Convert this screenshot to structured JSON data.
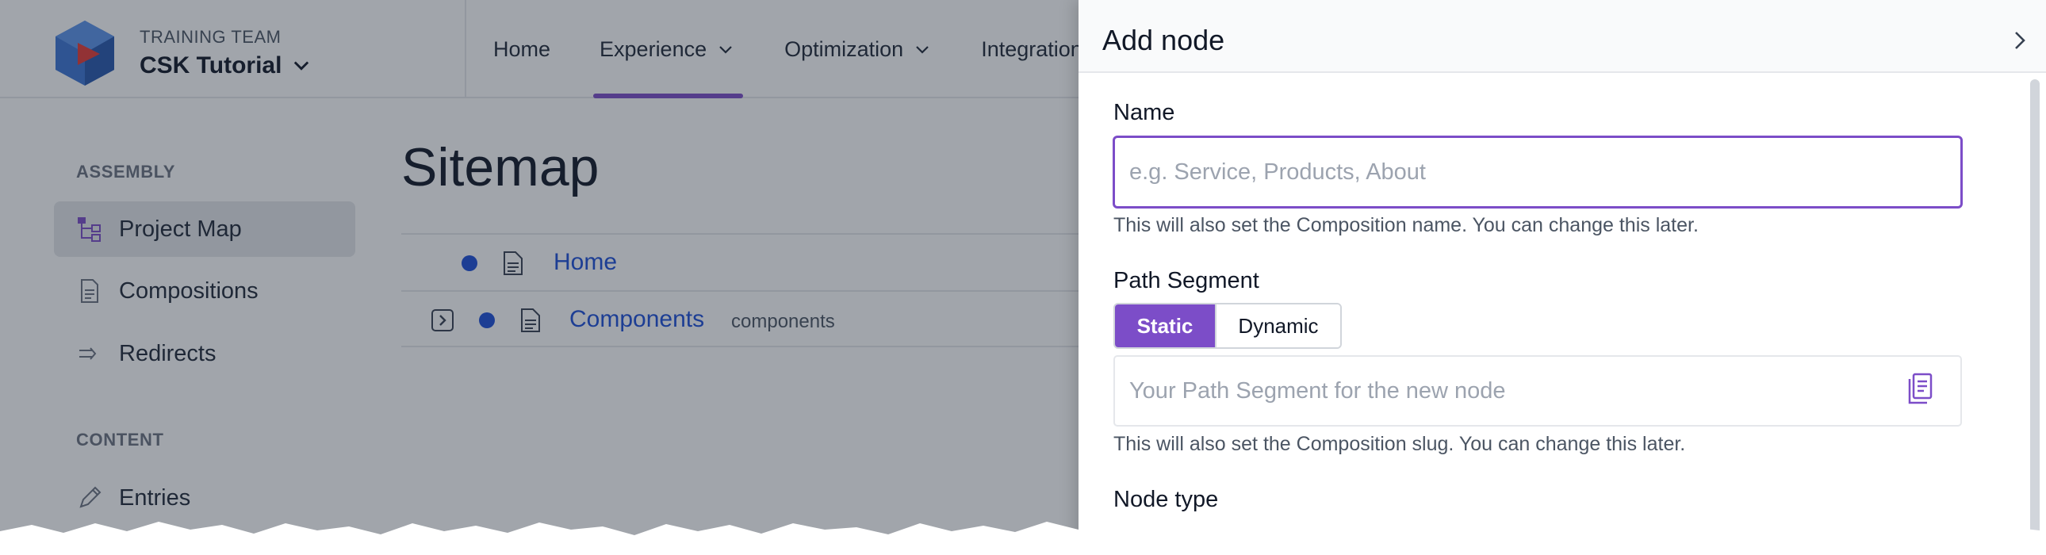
{
  "colors": {
    "accent": "#7c4dc8",
    "link": "#1d4ed8",
    "overlay": "rgba(31,41,55,0.42)"
  },
  "header": {
    "team": "TRAINING TEAM",
    "project": "CSK Tutorial",
    "nav": [
      {
        "label": "Home"
      },
      {
        "label": "Experience",
        "active": true
      },
      {
        "label": "Optimization"
      },
      {
        "label": "Integrations"
      }
    ]
  },
  "sidebar": {
    "section1": "ASSEMBLY",
    "items": [
      {
        "label": "Project Map",
        "icon": "project-map-icon",
        "active": true
      },
      {
        "label": "Compositions",
        "icon": "document-icon"
      },
      {
        "label": "Redirects",
        "icon": "redirect-icon"
      }
    ],
    "section2": "CONTENT",
    "items2": [
      {
        "label": "Entries",
        "icon": "pencil-icon"
      }
    ]
  },
  "main": {
    "title": "Sitemap",
    "rows": [
      {
        "label": "Home",
        "slug": ""
      },
      {
        "label": "Components",
        "slug": "components"
      }
    ]
  },
  "drawer": {
    "title": "Add node",
    "name_label": "Name",
    "name_placeholder": "e.g. Service, Products, About",
    "name_help": "This will also set the Composition name. You can change this later.",
    "path_label": "Path Segment",
    "path_static": "Static",
    "path_dynamic": "Dynamic",
    "path_placeholder": "Your Path Segment for the new node",
    "path_help": "This will also set the Composition slug. You can change this later.",
    "node_type_label": "Node type"
  }
}
